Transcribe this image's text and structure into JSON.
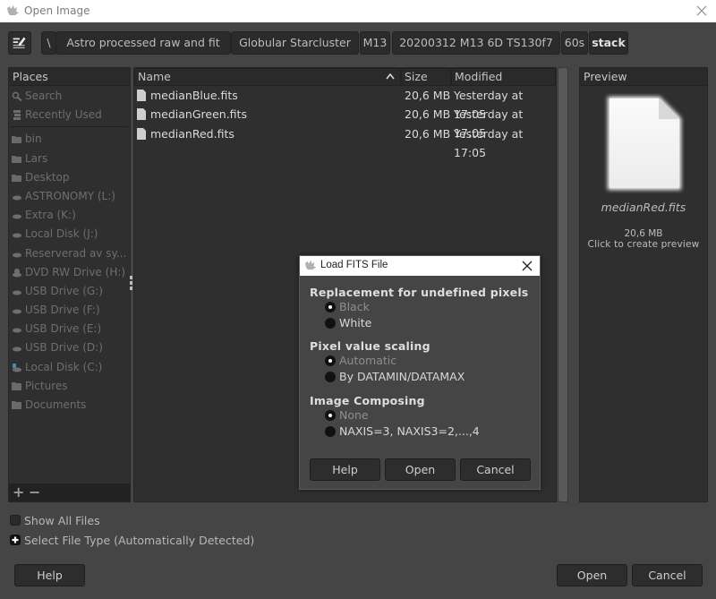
{
  "window": {
    "title": "Open Image",
    "icon": "gimp-wilber-icon",
    "close_icon": "close-icon"
  },
  "pathbar": {
    "edit_icon": "edit-location-icon",
    "crumbs": [
      {
        "label": "\\"
      },
      {
        "label": "Astro processed raw and fit"
      },
      {
        "label": "Globular Starcluster"
      },
      {
        "label": "M13"
      },
      {
        "label": "20200312 M13 6D TS130f7"
      },
      {
        "label": "60s"
      },
      {
        "label": "stack",
        "active": true
      }
    ]
  },
  "places": {
    "header": "Places",
    "items": [
      {
        "label": "Search",
        "icon": "search-icon"
      },
      {
        "label": "Recently Used",
        "icon": "recent-icon"
      },
      {
        "label": "bin",
        "icon": "folder-icon"
      },
      {
        "label": "Lars",
        "icon": "folder-icon"
      },
      {
        "label": "Desktop",
        "icon": "folder-icon"
      },
      {
        "label": "ASTRONOMY (L:)",
        "icon": "drive-icon"
      },
      {
        "label": "Extra (K:)",
        "icon": "drive-icon"
      },
      {
        "label": "Local Disk (J:)",
        "icon": "drive-icon"
      },
      {
        "label": "Reserverad av sy...",
        "icon": "drive-icon"
      },
      {
        "label": "DVD RW Drive (H:)",
        "icon": "optical-drive-icon"
      },
      {
        "label": "USB Drive (G:)",
        "icon": "drive-icon"
      },
      {
        "label": "USB Drive (F:)",
        "icon": "drive-icon"
      },
      {
        "label": "USB Drive (E:)",
        "icon": "drive-icon"
      },
      {
        "label": "USB Drive (D:)",
        "icon": "drive-icon"
      },
      {
        "label": "Local Disk (C:)",
        "icon": "system-drive-icon"
      },
      {
        "label": "Pictures",
        "icon": "folder-icon"
      },
      {
        "label": "Documents",
        "icon": "folder-icon"
      }
    ],
    "add_label": "+",
    "remove_label": "−"
  },
  "filelist": {
    "columns": {
      "name": "Name",
      "size": "Size",
      "modified": "Modified"
    },
    "sort_icon": "sort-ascending-icon",
    "files": [
      {
        "name": "medianBlue.fits",
        "size": "20,6 MB",
        "modified": "Yesterday at 17:05"
      },
      {
        "name": "medianGreen.fits",
        "size": "20,6 MB",
        "modified": "Yesterday at 17:05"
      },
      {
        "name": "medianRed.fits",
        "size": "20,6 MB",
        "modified": "Yesterday at 17:05"
      }
    ]
  },
  "preview": {
    "header": "Preview",
    "filename": "medianRed.fits",
    "size": "20,6 MB",
    "hint": "Click to create preview"
  },
  "options": {
    "show_all_files": {
      "label": "Show All Files",
      "checked": false
    },
    "select_file_type": {
      "label": "Select File Type (Automatically Detected)",
      "expanded": false
    }
  },
  "buttons": {
    "help": "Help",
    "open": "Open",
    "cancel": "Cancel"
  },
  "fits_dialog": {
    "title": "Load FITS File",
    "sections": [
      {
        "title": "Replacement for undefined pixels",
        "options": [
          {
            "label": "Black",
            "selected": true
          },
          {
            "label": "White",
            "selected": false
          }
        ]
      },
      {
        "title": "Pixel value scaling",
        "options": [
          {
            "label": "Automatic",
            "selected": true
          },
          {
            "label": "By DATAMIN/DATAMAX",
            "selected": false
          }
        ]
      },
      {
        "title": "Image Composing",
        "options": [
          {
            "label": "None",
            "selected": true
          },
          {
            "label": "NAXIS=3, NAXIS3=2,...,4",
            "selected": false
          }
        ]
      }
    ],
    "buttons": {
      "help": "Help",
      "open": "Open",
      "cancel": "Cancel"
    }
  }
}
